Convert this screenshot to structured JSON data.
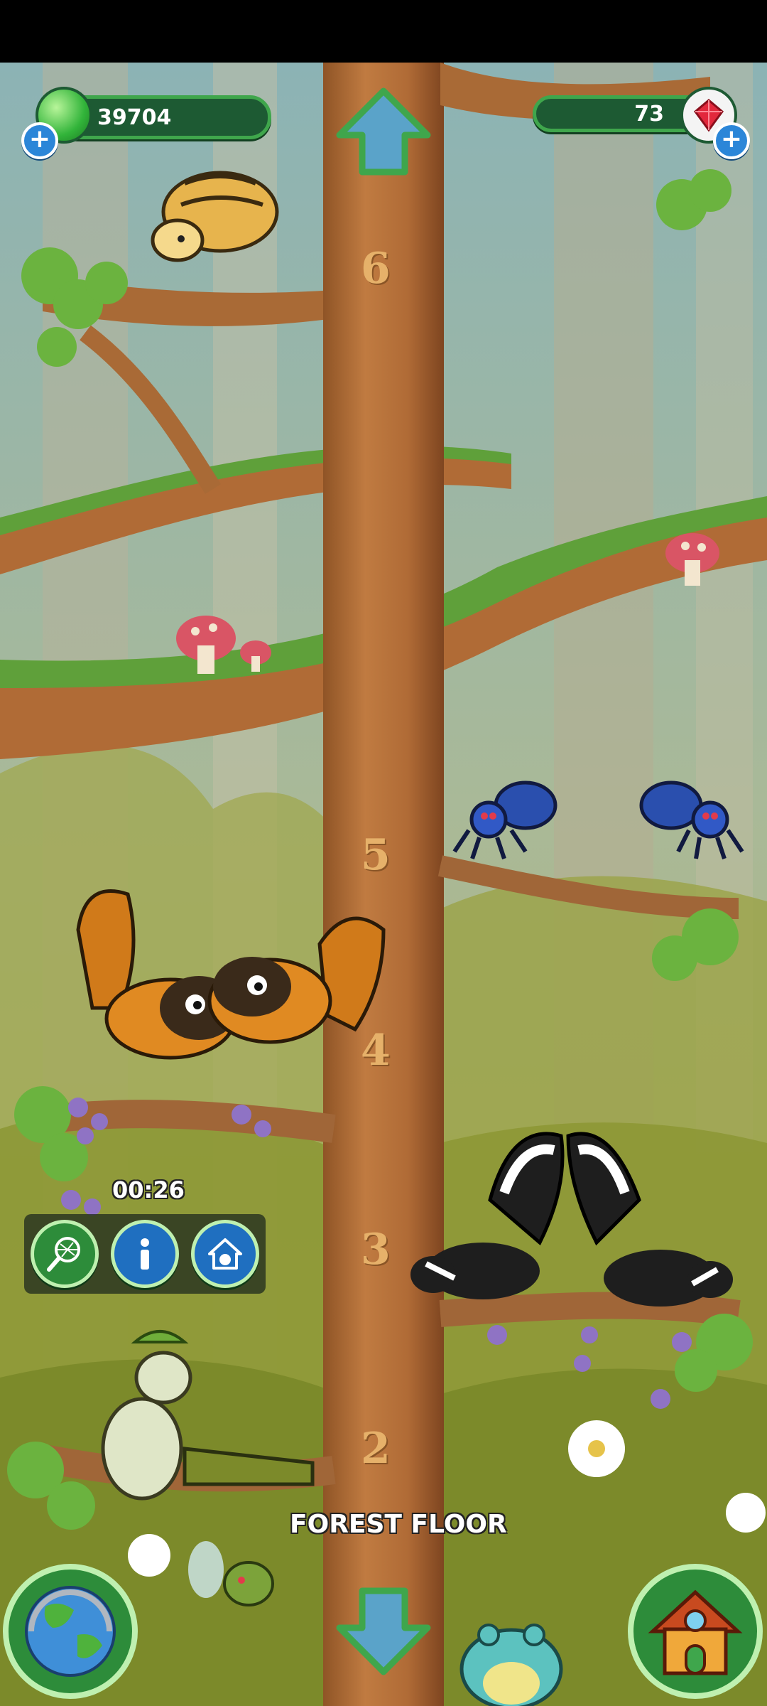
{
  "hud": {
    "gems_value": "39704",
    "diamonds_value": "73"
  },
  "floors": [
    "6",
    "5",
    "4",
    "3",
    "2"
  ],
  "timer": "00:26",
  "actions": [
    {
      "name": "net-icon"
    },
    {
      "name": "info-icon"
    },
    {
      "name": "habitat-icon"
    }
  ],
  "floor_label": "FOREST FLOOR",
  "colors": {
    "trunk": "#b5713a",
    "hud_green": "#3fa64c",
    "plus_blue": "#2b86d8",
    "diamond_red": "#e2283c"
  },
  "icons": [
    "gem-green-icon",
    "diamond-icon",
    "arrow-up-icon",
    "arrow-down-icon",
    "globe-icon",
    "house-icon"
  ]
}
